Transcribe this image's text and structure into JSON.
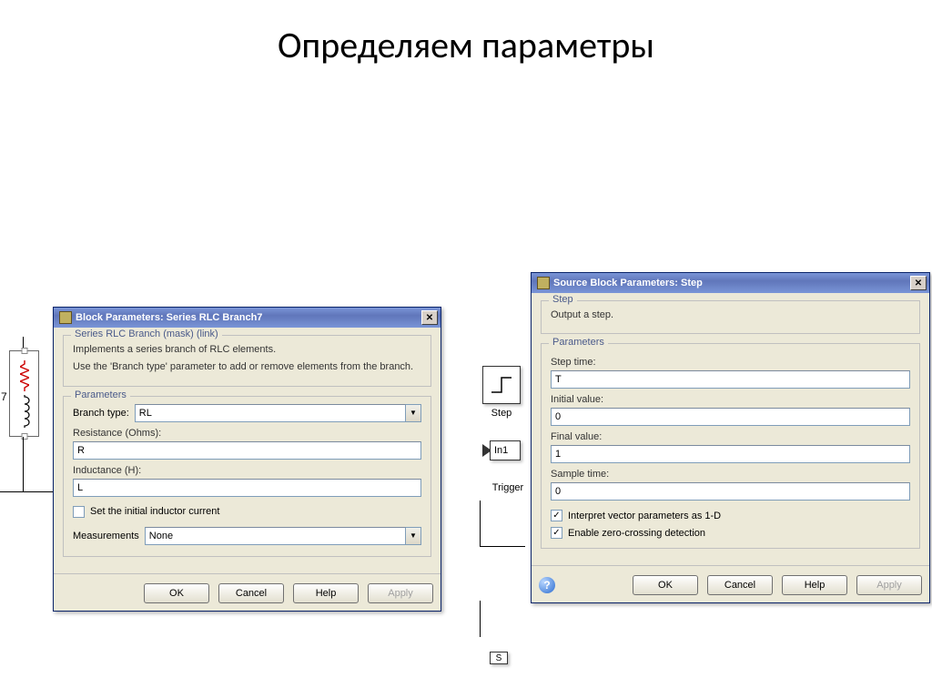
{
  "slide": {
    "title": "Определяем параметры"
  },
  "rlc_dialog": {
    "title": "Block Parameters: Series RLC Branch7",
    "mask_legend": "Series RLC Branch (mask) (link)",
    "desc1": "Implements a series branch of RLC elements.",
    "desc2": "Use the 'Branch type' parameter to add or remove elements from the branch.",
    "params_legend": "Parameters",
    "branch_type_label": "Branch type:",
    "branch_type_value": "RL",
    "resistance_label": "Resistance (Ohms):",
    "resistance_value": "R",
    "inductance_label": "Inductance (H):",
    "inductance_value": "L",
    "init_current_label": "Set the initial inductor current",
    "measurements_label": "Measurements",
    "measurements_value": "None",
    "ok": "OK",
    "cancel": "Cancel",
    "help": "Help",
    "apply": "Apply"
  },
  "step_dialog": {
    "title": "Source Block Parameters: Step",
    "step_legend": "Step",
    "step_desc": "Output a step.",
    "params_legend": "Parameters",
    "step_time_label": "Step time:",
    "step_time_value": "T",
    "initial_label": "Initial value:",
    "initial_value": "0",
    "final_label": "Final value:",
    "final_value": "1",
    "sample_label": "Sample time:",
    "sample_value": "0",
    "interp_label": "Interpret vector parameters as 1-D",
    "zc_label": "Enable zero-crossing detection",
    "ok": "OK",
    "cancel": "Cancel",
    "help": "Help",
    "apply": "Apply"
  },
  "diagram": {
    "step_label": "Step",
    "in1": "In1",
    "trigger_label": "Trigger",
    "s": "S",
    "seven": "7"
  }
}
